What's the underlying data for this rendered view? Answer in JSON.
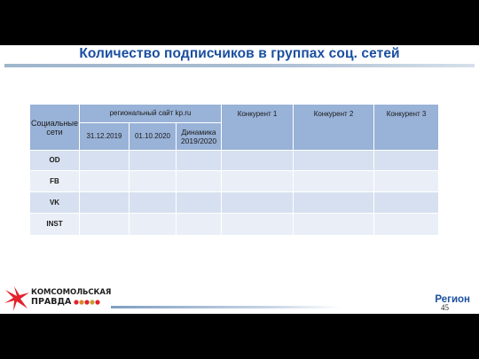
{
  "slide": {
    "title": "Количество подписчиков в группах соц. сетей",
    "region": "Регион",
    "page_number": "45"
  },
  "logo": {
    "line1": "КОМСОМОЛЬСКАЯ",
    "line2": "ПРАВДА"
  },
  "table": {
    "header": {
      "social": "Социальные сети",
      "regional_site": "региональный сайт kp.ru",
      "competitor1": "Конкурент 1",
      "competitor2": "Конкурент 2",
      "competitor3": "Конкурент 3",
      "date1": "31.12.2019",
      "date2": "01.10.2020",
      "dynamics": "Динамика 2019/2020"
    },
    "rows": [
      {
        "label": "OD",
        "cells": [
          "",
          "",
          "",
          "",
          "",
          ""
        ]
      },
      {
        "label": "FB",
        "cells": [
          "",
          "",
          "",
          "",
          "",
          ""
        ]
      },
      {
        "label": "VK",
        "cells": [
          "",
          "",
          "",
          "",
          "",
          ""
        ]
      },
      {
        "label": "INST",
        "cells": [
          "",
          "",
          "",
          "",
          "",
          ""
        ]
      }
    ]
  },
  "colors": {
    "title": "#1a4fa0",
    "header_fill": "#99b2d7",
    "row_dark": "#d6e0f0",
    "row_light": "#eaeff7",
    "logo_red": "#e3222b"
  }
}
